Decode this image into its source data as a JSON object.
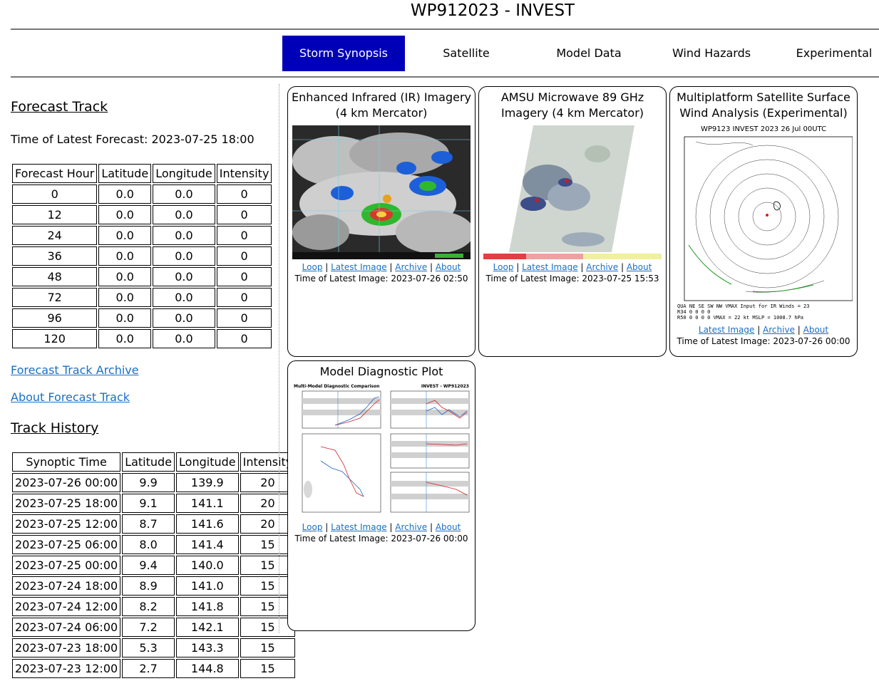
{
  "header": {
    "title": "WP912023 - INVEST"
  },
  "nav": {
    "tabs": [
      {
        "label": "Storm Synopsis",
        "active": true
      },
      {
        "label": "Satellite",
        "active": false
      },
      {
        "label": "Model Data",
        "active": false
      },
      {
        "label": "Wind Hazards",
        "active": false
      },
      {
        "label": "Experimental",
        "active": false
      }
    ]
  },
  "forecast": {
    "title": "Forecast Track",
    "latest_label": "Time of Latest Forecast: 2023-07-25 18:00",
    "columns": [
      "Forecast Hour",
      "Latitude",
      "Longitude",
      "Intensity"
    ],
    "rows": [
      [
        "0",
        "0.0",
        "0.0",
        "0"
      ],
      [
        "12",
        "0.0",
        "0.0",
        "0"
      ],
      [
        "24",
        "0.0",
        "0.0",
        "0"
      ],
      [
        "36",
        "0.0",
        "0.0",
        "0"
      ],
      [
        "48",
        "0.0",
        "0.0",
        "0"
      ],
      [
        "72",
        "0.0",
        "0.0",
        "0"
      ],
      [
        "96",
        "0.0",
        "0.0",
        "0"
      ],
      [
        "120",
        "0.0",
        "0.0",
        "0"
      ]
    ],
    "archive_link": "Forecast Track Archive",
    "about_link": "About Forecast Track"
  },
  "history": {
    "title": "Track History",
    "columns": [
      "Synoptic Time",
      "Latitude",
      "Longitude",
      "Intensity"
    ],
    "rows": [
      [
        "2023-07-26 00:00",
        "9.9",
        "139.9",
        "20"
      ],
      [
        "2023-07-25 18:00",
        "9.1",
        "141.1",
        "20"
      ],
      [
        "2023-07-25 12:00",
        "8.7",
        "141.6",
        "20"
      ],
      [
        "2023-07-25 06:00",
        "8.0",
        "141.4",
        "15"
      ],
      [
        "2023-07-25 00:00",
        "9.4",
        "140.0",
        "15"
      ],
      [
        "2023-07-24 18:00",
        "8.9",
        "141.0",
        "15"
      ],
      [
        "2023-07-24 12:00",
        "8.2",
        "141.8",
        "15"
      ],
      [
        "2023-07-24 06:00",
        "7.2",
        "142.1",
        "15"
      ],
      [
        "2023-07-23 18:00",
        "5.3",
        "143.3",
        "15"
      ],
      [
        "2023-07-23 12:00",
        "2.7",
        "144.8",
        "15"
      ]
    ]
  },
  "cards": {
    "ir": {
      "title": "Enhanced Infrared (IR) Imagery (4 km Mercator)",
      "links": [
        "Loop",
        "Latest Image",
        "Archive",
        "About"
      ],
      "time": "Time of Latest Image: 2023-07-26 02:50"
    },
    "amsu": {
      "title": "AMSU Microwave 89 GHz Imagery (4 km Mercator)",
      "links": [
        "Loop",
        "Latest Image",
        "Archive",
        "About"
      ],
      "time": "Time of Latest Image: 2023-07-25 15:53"
    },
    "wind": {
      "title": "Multiplatform Satellite Surface Wind Analysis (Experimental)",
      "image_header": "WP9123    INVEST    2023 26 Jul 00UTC",
      "links": [
        "Latest Image",
        "Archive",
        "About"
      ],
      "time": "Time of Latest Image: 2023-07-26 00:00"
    },
    "model": {
      "title": "Model Diagnostic Plot",
      "image_header_left": "Multi-Model Diagnostic Comparison",
      "image_header_right": "INVEST - WP912023",
      "links": [
        "Loop",
        "Latest Image",
        "Archive",
        "About"
      ],
      "time": "Time of Latest Image: 2023-07-26 00:00"
    }
  }
}
